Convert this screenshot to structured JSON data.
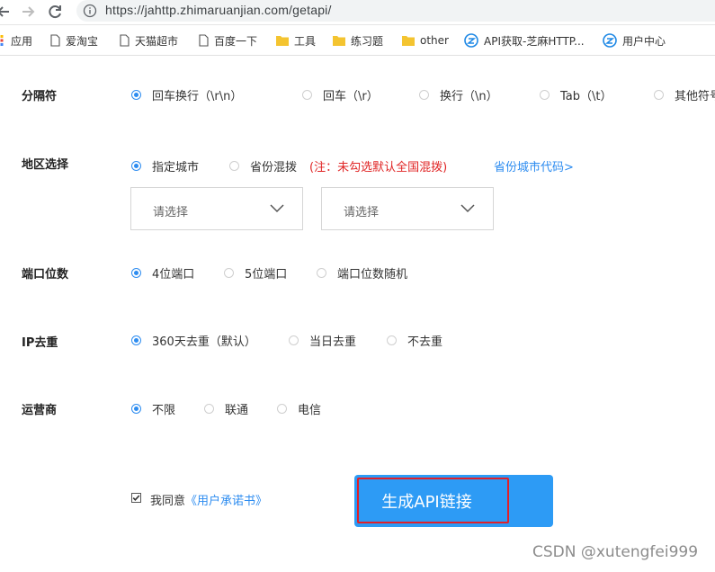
{
  "browser": {
    "url": "https://jahttp.zhimaruanjian.com/getapi/",
    "bookmarks": [
      "应用",
      "爱淘宝",
      "天猫超市",
      "百度一下",
      "工具",
      "练习题",
      "other",
      "API获取-芝麻HTTP...",
      "用户中心"
    ]
  },
  "form": {
    "separator": {
      "label": "分隔符",
      "options": [
        "回车换行（\\r\\n）",
        "回车（\\r）",
        "换行（\\n）",
        "Tab（\\t）",
        "其他符号"
      ],
      "selected": 0
    },
    "region": {
      "label": "地区选择",
      "options": [
        "指定城市",
        "省份混拨"
      ],
      "selected": 0,
      "note": "(注：未勾选默认全国混拨)",
      "code_link": "省份城市代码>",
      "select1_placeholder": "请选择",
      "select2_placeholder": "请选择"
    },
    "port": {
      "label": "端口位数",
      "options": [
        "4位端口",
        "5位端口",
        "端口位数随机"
      ],
      "selected": 0
    },
    "dedup": {
      "label": "IP去重",
      "options": [
        "360天去重（默认）",
        "当日去重",
        "不去重"
      ],
      "selected": 0
    },
    "isp": {
      "label": "运营商",
      "options": [
        "不限",
        "联通",
        "电信"
      ],
      "selected": 0
    },
    "agree_text": "我同意",
    "agree_link": "《用户承诺书》",
    "agree_checked": true,
    "generate_button": "生成API链接"
  },
  "watermark": "CSDN @xutengfei999",
  "colors": {
    "accent": "#2d8cf0",
    "button": "#2d9bf5",
    "note": "#e02424",
    "highlight": "#e0202a"
  }
}
